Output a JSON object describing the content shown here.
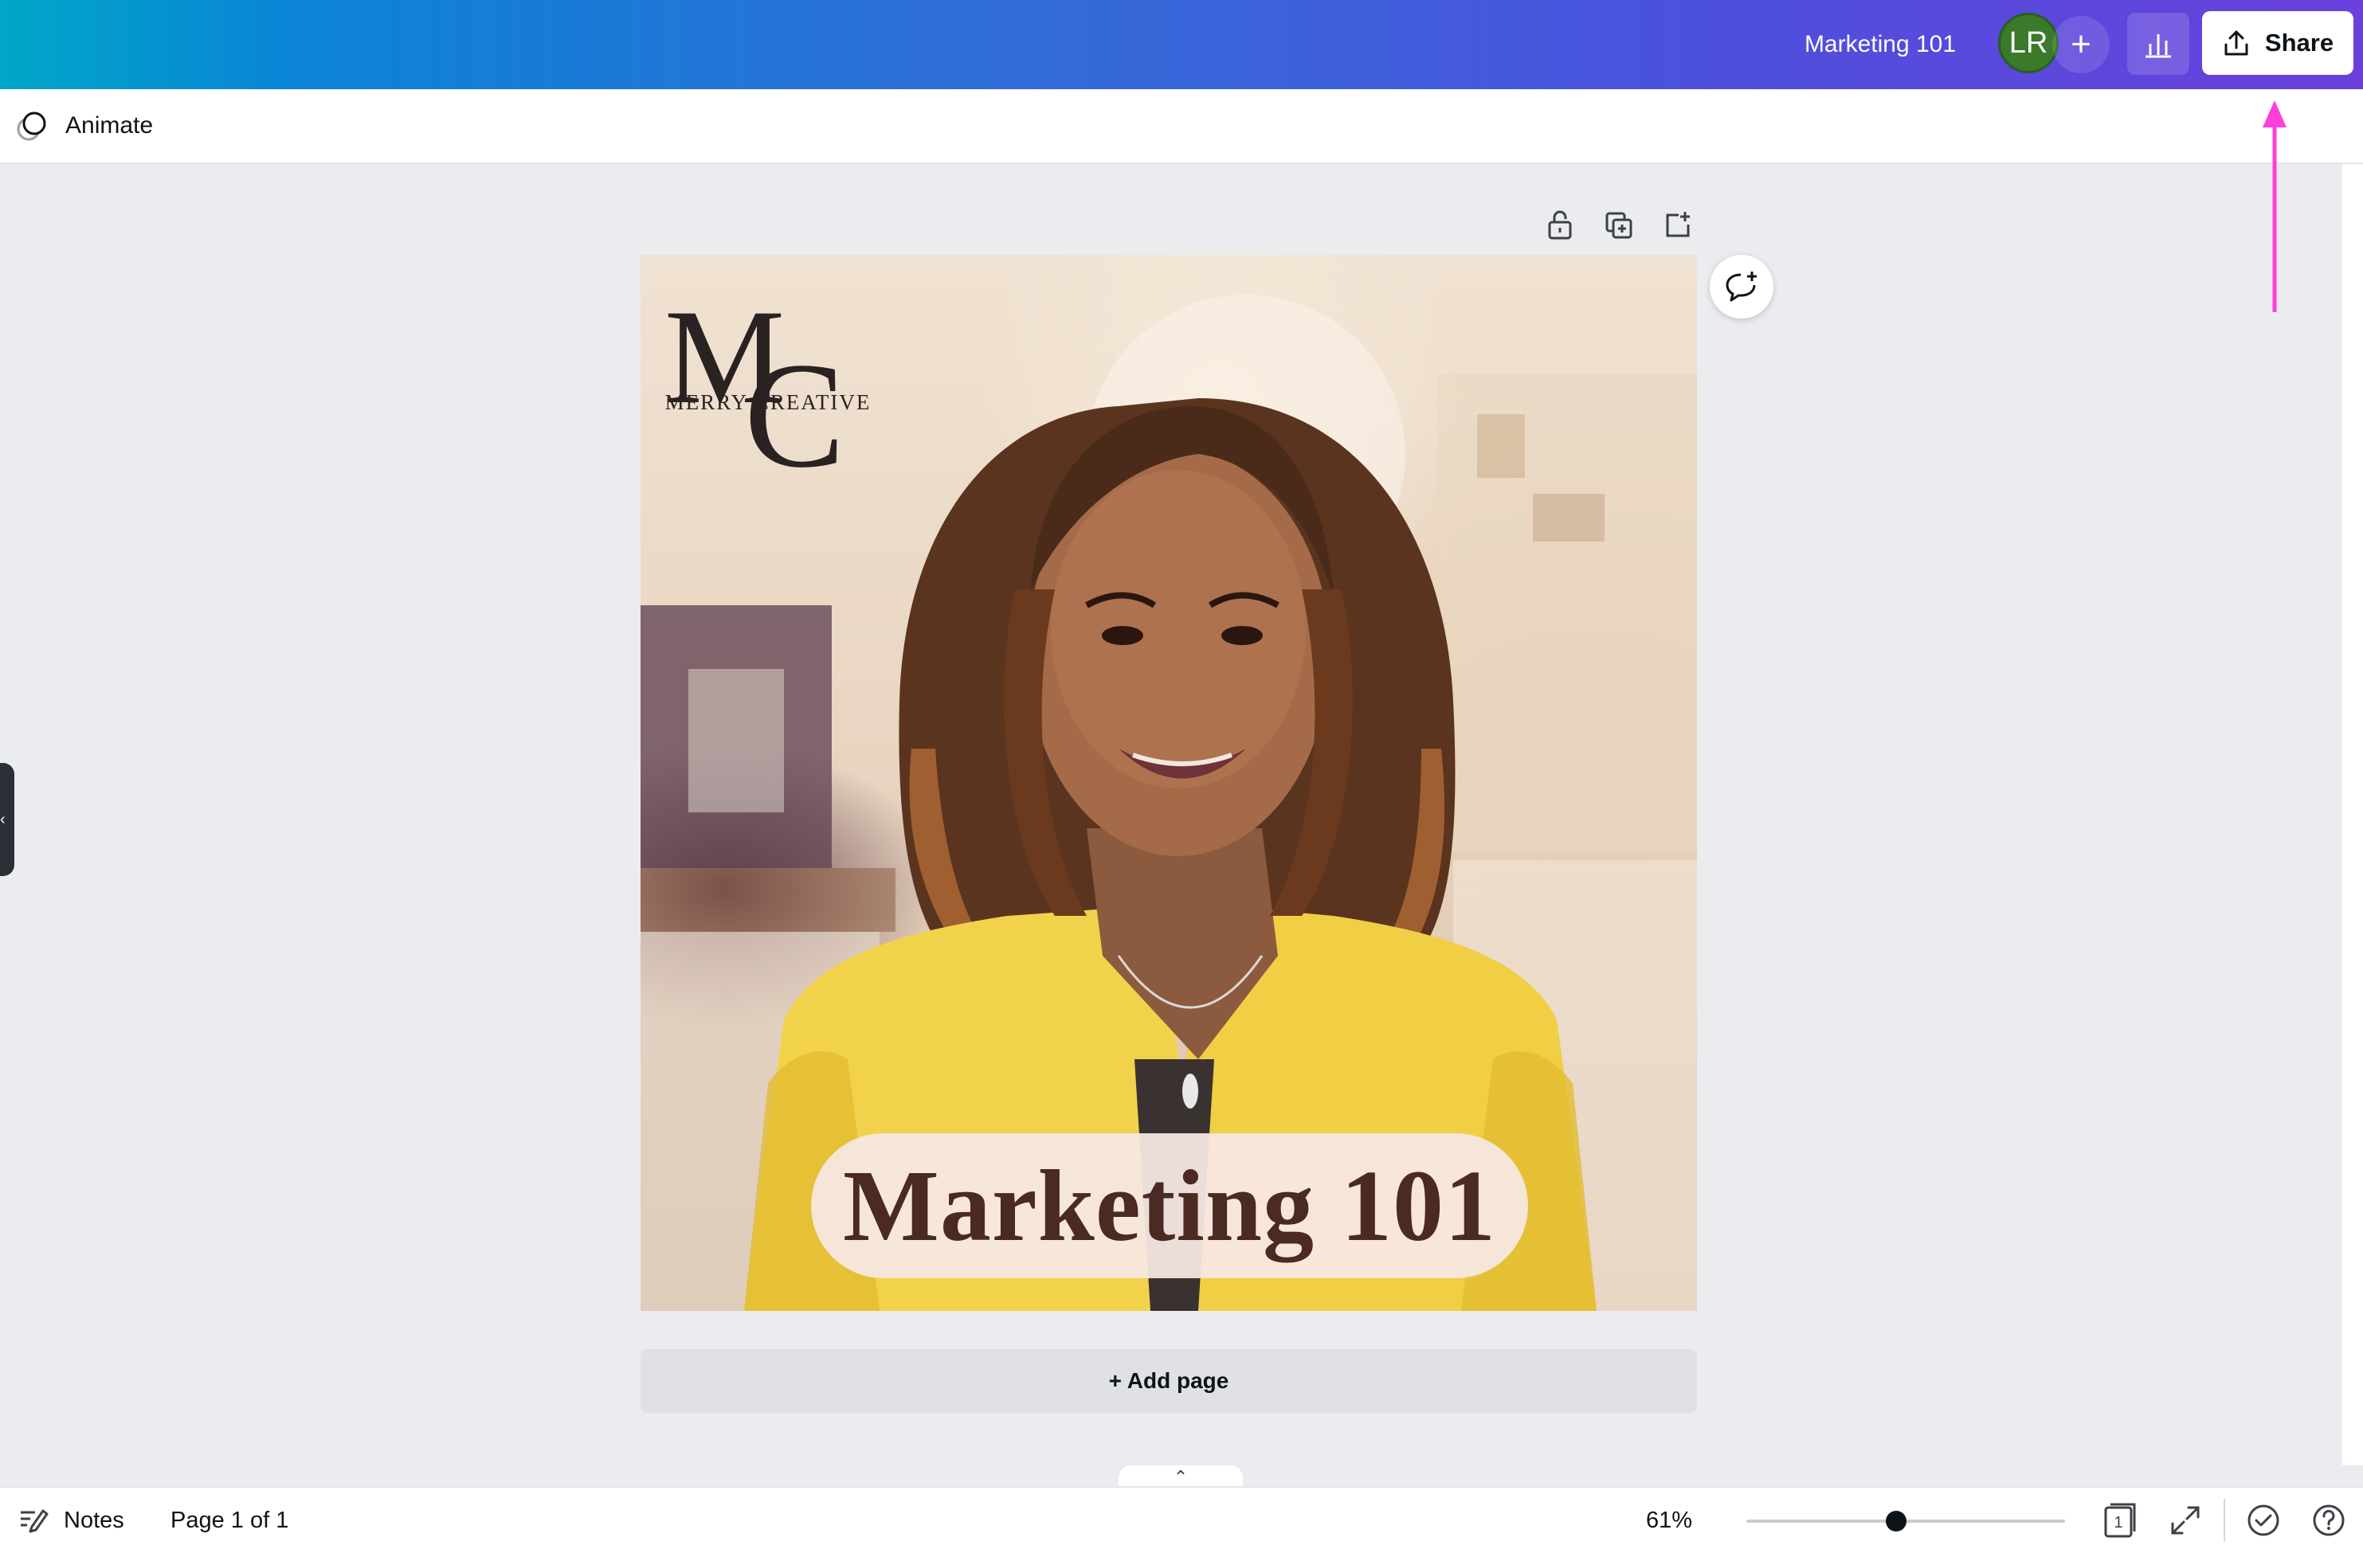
{
  "header": {
    "doc_title": "Marketing 101",
    "avatar_initials": "LR",
    "add_collaborator_label": "+",
    "share_label": "Share"
  },
  "toolbar": {
    "animate_label": "Animate"
  },
  "canvas": {
    "logo_text": "MERRY CREATIVE",
    "headline": "Marketing 101",
    "add_page_label": "+ Add page"
  },
  "footer": {
    "notes_label": "Notes",
    "page_indicator": "Page 1 of 1",
    "zoom_label": "61%",
    "zoom_level": 0.47,
    "page_grid_count": "1"
  },
  "colors": {
    "share_arrow": "#ff3fd8",
    "headline_text": "#4a2a22"
  }
}
